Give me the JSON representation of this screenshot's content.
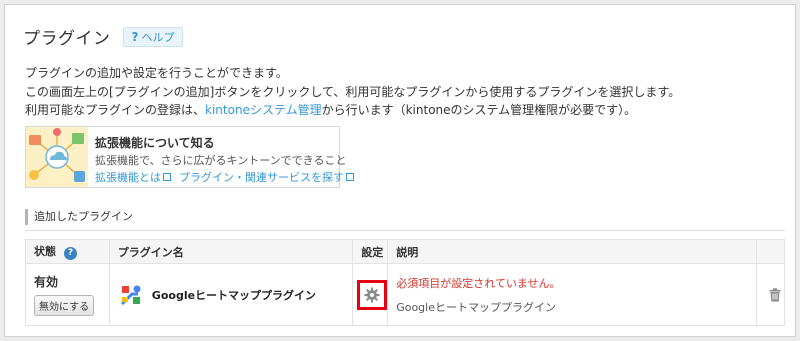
{
  "header": {
    "title": "プラグイン",
    "help_label": "ヘルプ",
    "help_mark": "?"
  },
  "description": {
    "line1": "プラグインの追加や設定を行うことができます。",
    "line2": "この画面左上の[プラグインの追加]ボタンをクリックして、利用可能なプラグインから使用するプラグインを選択します。",
    "line3_prefix": "利用可能なプラグインの登録は、",
    "line3_link": "kintoneシステム管理",
    "line3_suffix": "から行います（kintoneのシステム管理権限が必要です）。"
  },
  "promo": {
    "title": "拡張機能について知る",
    "subtitle": "拡張機能で、さらに広がるキントーンでできること",
    "link1": "拡張機能とは",
    "link2": "プラグイン・関連サービスを探す"
  },
  "section": {
    "title": "追加したプラグイン"
  },
  "table": {
    "headers": {
      "status": "状態",
      "name": "プラグイン名",
      "settings": "設定",
      "description": "説明"
    },
    "rows": [
      {
        "status": "有効",
        "disable_button": "無効にする",
        "name": "Googleヒートマッププラグイン",
        "warning": "必須項目が設定されていません。",
        "description": "Googleヒートマッププラグイン",
        "settings_icon": "gear-icon",
        "delete_icon": "trash-icon"
      }
    ]
  },
  "colors": {
    "accent": "#3498db",
    "warning": "#d9342b",
    "highlight_border": "#e60012"
  }
}
